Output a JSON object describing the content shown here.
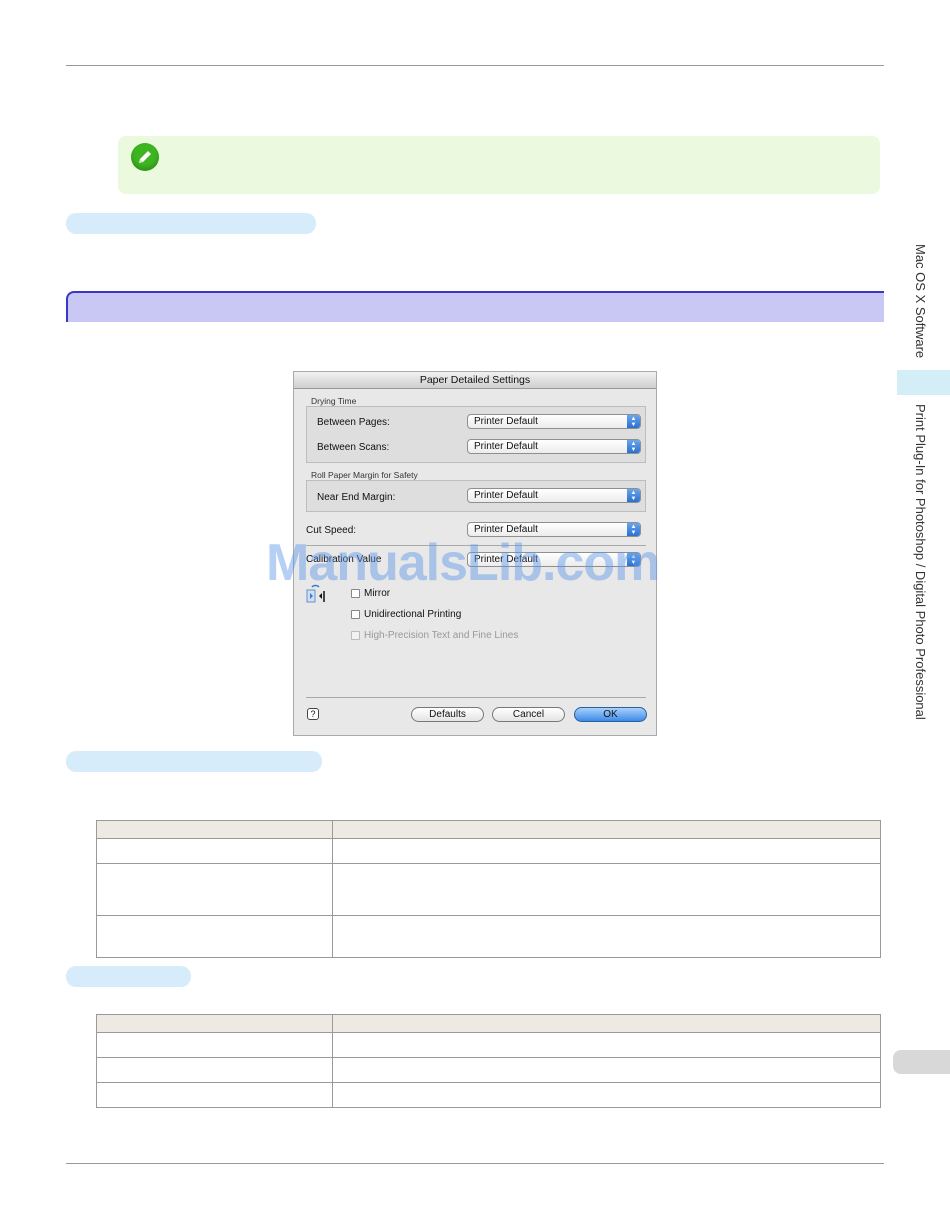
{
  "sidebar": {
    "top_label": "Mac OS X Software",
    "main_label": "Print Plug-In for Photoshop / Digital Photo Professional"
  },
  "dialog": {
    "title": "Paper Detailed Settings",
    "drying_time_label": "Drying Time",
    "between_pages_label": "Between Pages:",
    "between_pages_value": "Printer Default",
    "between_scans_label": "Between Scans:",
    "between_scans_value": "Printer Default",
    "roll_margin_label": "Roll Paper Margin for Safety",
    "near_end_label": "Near End Margin:",
    "near_end_value": "Printer Default",
    "cut_speed_label": "Cut Speed:",
    "cut_speed_value": "Printer Default",
    "calibration_label": "Calibration Value",
    "calibration_value": "Printer Default",
    "mirror_label": "Mirror",
    "unidirectional_label": "Unidirectional Printing",
    "high_precision_label": "High-Precision Text and Fine Lines",
    "defaults_button": "Defaults",
    "cancel_button": "Cancel",
    "ok_button": "OK",
    "help_glyph": "?"
  },
  "watermark": "ManualsLib.com",
  "colors": {
    "note_bg": "#ebf9df",
    "pill_bg": "#d7ecfa",
    "section_head_bg": "#c9c7f4",
    "section_head_border": "#3a37c0",
    "table_header_bg": "#efe9e3"
  }
}
